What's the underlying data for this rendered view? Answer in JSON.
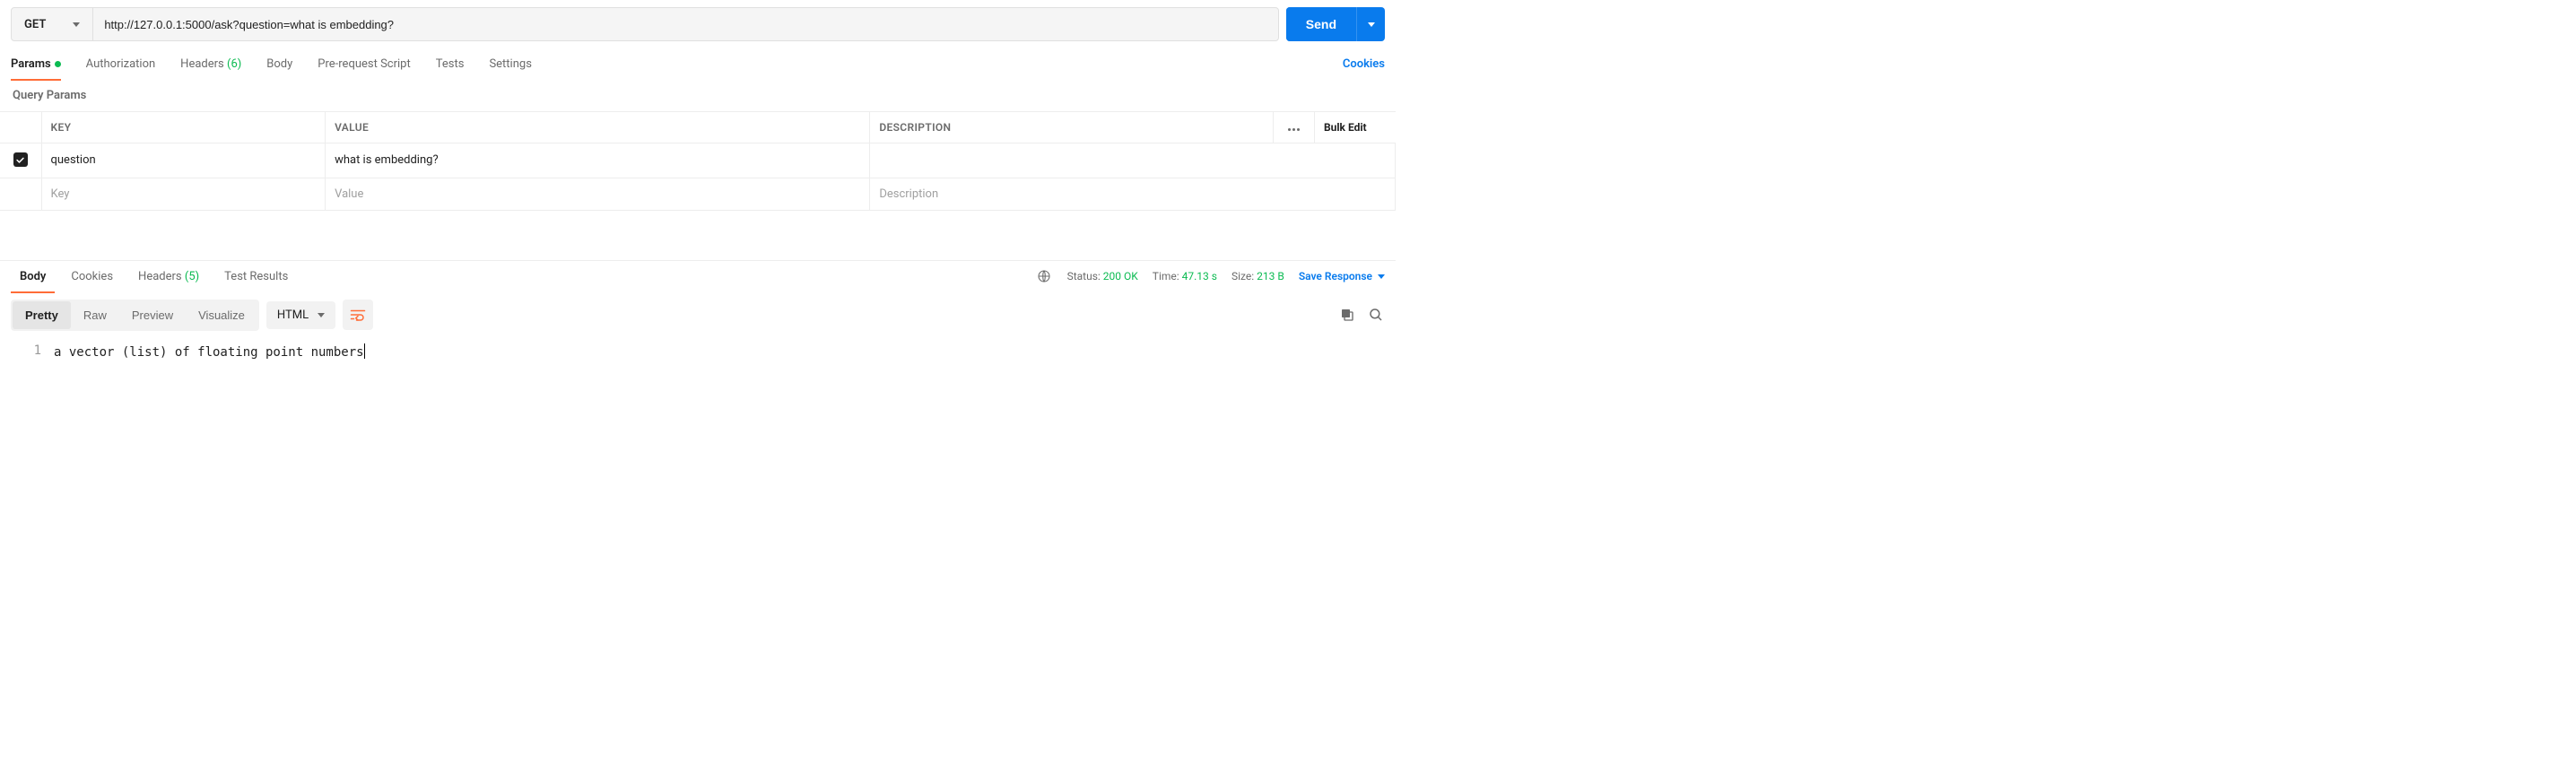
{
  "request": {
    "method": "GET",
    "url": "http://127.0.0.1:5000/ask?question=what is embedding?",
    "send_label": "Send"
  },
  "req_tabs": {
    "params": "Params",
    "authorization": "Authorization",
    "headers": "Headers",
    "headers_count": "(6)",
    "body": "Body",
    "prerequest": "Pre-request Script",
    "tests": "Tests",
    "settings": "Settings",
    "cookies_link": "Cookies"
  },
  "query_params": {
    "title": "Query Params",
    "headers": {
      "key": "KEY",
      "value": "VALUE",
      "description": "DESCRIPTION",
      "bulk": "Bulk Edit"
    },
    "rows": [
      {
        "checked": true,
        "key": "question",
        "value": "what is embedding?",
        "description": ""
      }
    ],
    "placeholder": {
      "key": "Key",
      "value": "Value",
      "description": "Description"
    }
  },
  "resp_tabs": {
    "body": "Body",
    "cookies": "Cookies",
    "headers": "Headers",
    "headers_count": "(5)",
    "tests": "Test Results"
  },
  "resp_meta": {
    "status_label": "Status:",
    "status_value": "200 OK",
    "time_label": "Time:",
    "time_value": "47.13 s",
    "size_label": "Size:",
    "size_value": "213 B",
    "save_label": "Save Response"
  },
  "viewer": {
    "pretty": "Pretty",
    "raw": "Raw",
    "preview": "Preview",
    "visualize": "Visualize",
    "format": "HTML"
  },
  "response_body": {
    "line_number": "1",
    "content": "a vector (list) of floating point numbers"
  }
}
